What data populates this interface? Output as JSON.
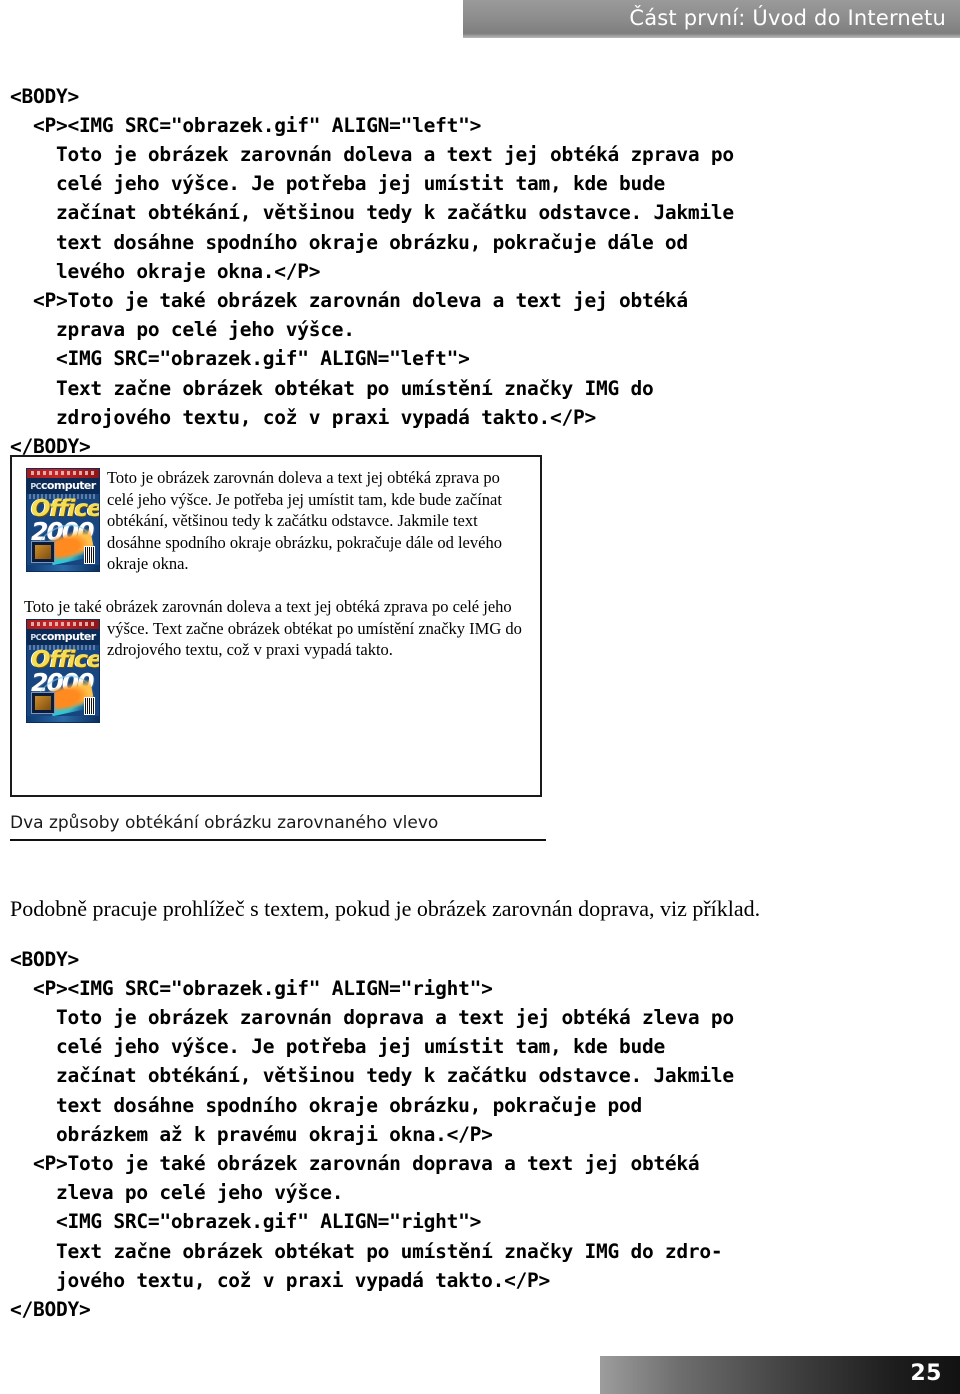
{
  "page": {
    "number": "25",
    "running_head": "Část první: Úvod do Internetu",
    "colors": {
      "running_head_bar": "#8b8b8b",
      "running_head_text": "#ffffff",
      "folio_bar_dark": "#121212",
      "folio_text": "#ffffff",
      "body_text": "#000000",
      "rule": "#111111"
    }
  },
  "code_block_left": "<BODY>\n  <P><IMG SRC=\"obrazek.gif\" ALIGN=\"left\">\n    Toto je obrázek zarovnán doleva a text jej obtéká zprava po\n    celé jeho výšce. Je potřeba jej umístit tam, kde bude\n    začínat obtékání, většinou tedy k začátku odstavce. Jakmile\n    text dosáhne spodního okraje obrázku, pokračuje dále od\n    levého okraje okna.</P>\n  <P>Toto je také obrázek zarovnán doleva a text jej obtéká\n    zprava po celé jeho výšce.\n    <IMG SRC=\"obrazek.gif\" ALIGN=\"left\">\n    Text začne obrázek obtékat po umístění značky IMG do\n    zdrojového textu, což v praxi vypadá takto.</P>\n</BODY>",
  "code_block_right": "<BODY>\n  <P><IMG SRC=\"obrazek.gif\" ALIGN=\"right\">\n    Toto je obrázek zarovnán doprava a text jej obtéká zleva po\n    celé jeho výšce. Je potřeba jej umístit tam, kde bude\n    začínat obtékání, většinou tedy k začátku odstavce. Jakmile\n    text dosáhne spodního okraje obrázku, pokračuje pod\n    obrázkem až k pravému okraji okna.</P>\n  <P>Toto je také obrázek zarovnán doprava a text jej obtéká\n    zleva po celé jeho výšce.\n    <IMG SRC=\"obrazek.gif\" ALIGN=\"right\">\n    Text začne obrázek obtékat po umístění značky IMG do zdro-\n    jového textu, což v praxi vypadá takto.</P>\n</BODY>",
  "figure": {
    "caption": "Dva způsoby obtékání obrázku zarovnaného vlevo",
    "browser_paragraph_1": "Toto je obrázek zarovnán doleva a text jej obtéká zprava po celé jeho výšce. Je potřeba jej umístit tam, kde bude začínat obtékání, většinou tedy k začátku odstavce. Jakmile text dosáhne spodního okraje obrázku, pokračuje dále od levého okraje okna.",
    "browser_paragraph_2a": "Toto je také obrázek zarovnán doleva a text jej obtéká zprava po celé jeho výšce. ",
    "browser_paragraph_2b": "Text začne obrázek obtékat po umístění značky IMG do zdrojového textu, což v praxi vypadá takto.",
    "cover_1": {
      "masthead_prefix": "PC",
      "masthead": "computer",
      "title_line_1": "Office",
      "title_line_2": "2000"
    },
    "cover_2": {
      "masthead_prefix": "PC",
      "masthead": "computer",
      "title_line_1": "Office",
      "title_line_2": "2000"
    }
  },
  "body_paragraph": "Podobně pracuje prohlížeč s textem, pokud je obrázek zarovnán doprava, viz příklad."
}
